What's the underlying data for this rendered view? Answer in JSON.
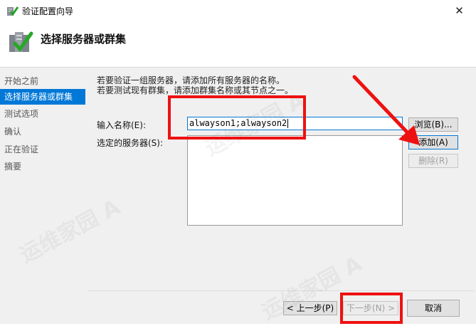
{
  "window": {
    "title": "验证配置向导",
    "close_glyph": "✕"
  },
  "header": {
    "title": "选择服务器或群集",
    "icon": "wizard-checkmark-icon"
  },
  "nav": {
    "items": [
      {
        "label": "开始之前",
        "active": false
      },
      {
        "label": "选择服务器或群集",
        "active": true
      },
      {
        "label": "测试选项",
        "active": false
      },
      {
        "label": "确认",
        "active": false
      },
      {
        "label": "正在验证",
        "active": false
      },
      {
        "label": "摘要",
        "active": false
      }
    ]
  },
  "main": {
    "description_line1": "若要验证一组服务器，请添加所有服务器的名称。",
    "description_line2": "若要测试现有群集，请添加群集名称或其节点之一。",
    "enter_name_label": "输入名称(E):",
    "enter_name_value": "alwayson1;alwayson2",
    "selected_servers_label": "选定的服务器(S):",
    "selected_servers": [],
    "browse_button": "浏览(B)...",
    "add_button": "添加(A)",
    "remove_button": "删除(R)"
  },
  "footer": {
    "back_button": "< 上一步(P)",
    "next_button": "下一步(N) >",
    "cancel_button": "取消"
  },
  "watermark": {
    "text": "运维家园 A"
  },
  "colors": {
    "accent": "#0078d7",
    "annotation_red": "#ee1111"
  }
}
